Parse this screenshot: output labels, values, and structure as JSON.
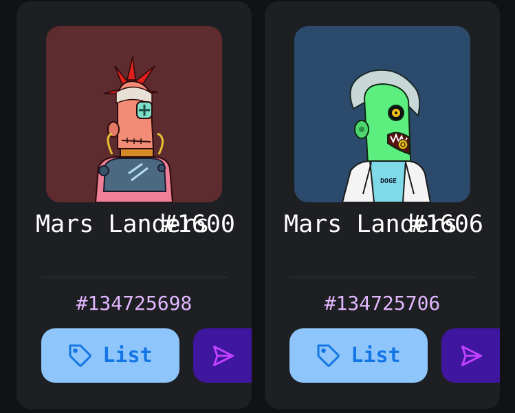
{
  "cards": [
    {
      "name": "Mars Landers",
      "number": "#1600",
      "token_id": "#134725698",
      "list_label": "List",
      "art_background": "#5e2b2e"
    },
    {
      "name": "Mars Landers",
      "number": "#1606",
      "token_id": "#134725706",
      "list_label": "List",
      "art_background": "#2c4a6b",
      "shirt_text": "DOGE"
    }
  ],
  "icons": {
    "list": "tag-icon",
    "send": "send-icon"
  },
  "colors": {
    "page_bg": "#111214",
    "card_bg": "#1e1f23",
    "token_id": "#e2b8ff",
    "list_button_bg": "#8ec5fb",
    "list_button_text": "#1475e6",
    "send_button_bg": "#3f169e",
    "send_icon": "#c040ff"
  }
}
